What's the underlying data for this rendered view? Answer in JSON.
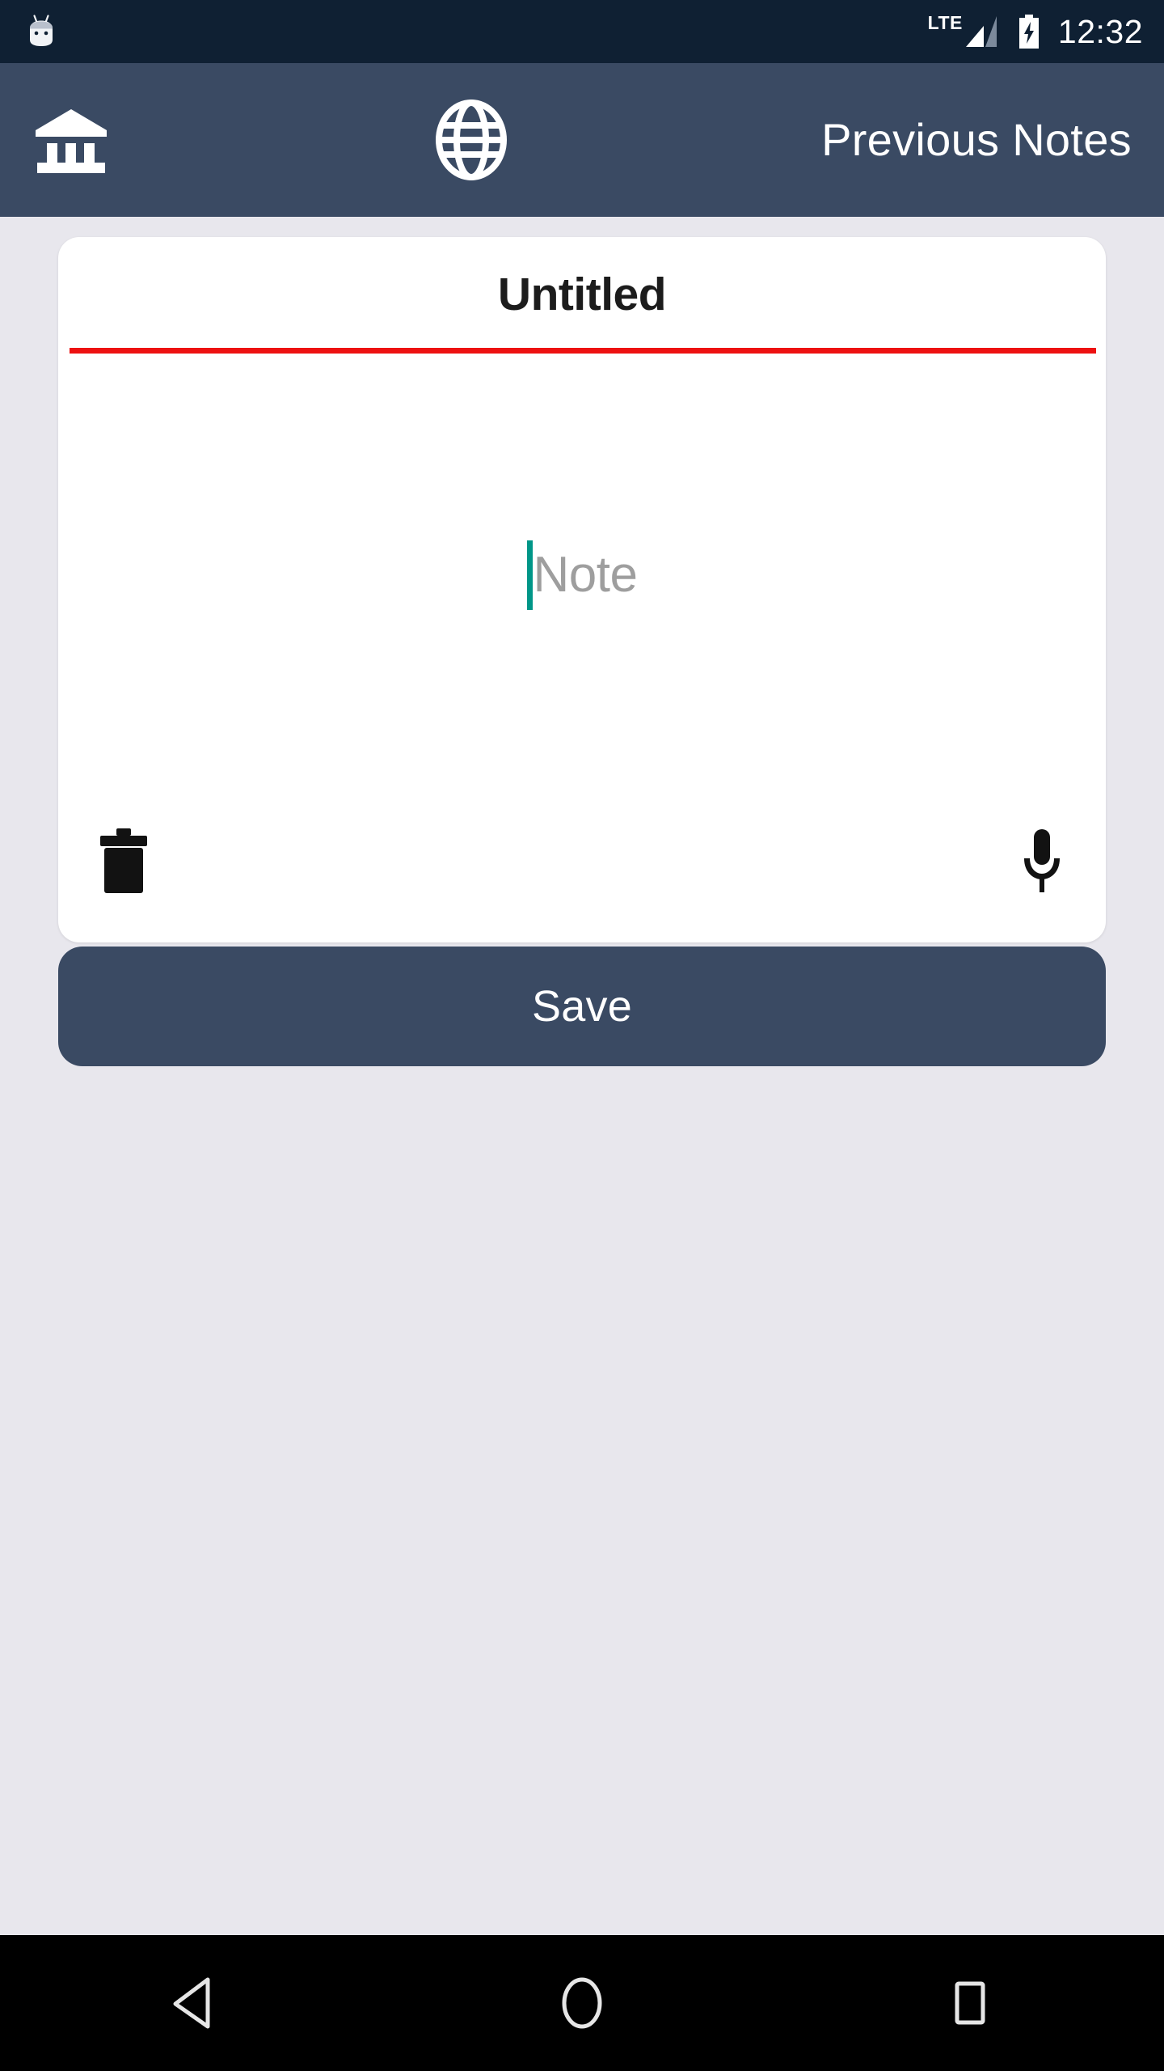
{
  "status_bar": {
    "android_logo_icon": "android-head-icon",
    "network_label": "LTE",
    "signal_icon": "signal-bars-icon",
    "battery_icon": "battery-charging-icon",
    "clock": "12:32",
    "background_color": "#0f2033"
  },
  "app_bar": {
    "background_color": "#3a4a63",
    "left_icon": "bank-building-icon",
    "center_icon": "globe-icon",
    "title": "Previous Notes"
  },
  "note_card": {
    "background_color": "#ffffff",
    "title_value": "Untitled",
    "title_placeholder": "Title",
    "title_underline_color": "#ed1111",
    "body_value": "",
    "body_placeholder": "Note",
    "caret_color": "#009688",
    "delete_icon": "trash-icon",
    "mic_icon": "microphone-icon"
  },
  "save_button": {
    "label": "Save",
    "background_color": "#3a4a63",
    "text_color": "#ffffff"
  },
  "page": {
    "background_color": "#e8e7ed"
  },
  "nav_bar": {
    "background_color": "#000000",
    "back_icon": "nav-back-triangle-icon",
    "home_icon": "nav-home-circle-icon",
    "recents_icon": "nav-recents-square-icon"
  }
}
